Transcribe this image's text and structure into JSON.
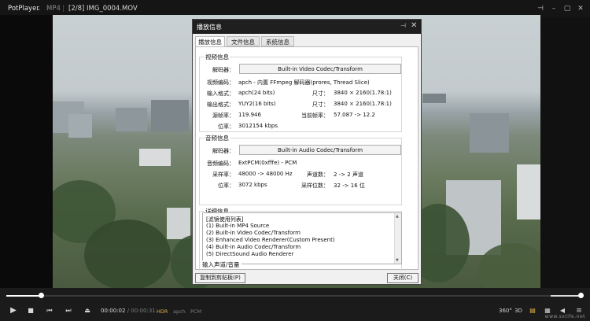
{
  "titlebar": {
    "app_name": "PotPlayer",
    "app_menu_icon": "chevron-down-icon",
    "format": "MP4",
    "separator": "|",
    "title": "[2/8] IMG_0004.MOV",
    "window_controls": [
      "pin-icon",
      "minimize-icon",
      "maximize-icon",
      "close-icon"
    ]
  },
  "dialog": {
    "title": "播放信息",
    "pin_glyph": "⊣",
    "close_glyph": "✕",
    "tabs": [
      "播放信息",
      "文件信息",
      "系统信息"
    ],
    "video": {
      "section_title": "视频信息",
      "decoder_label": "解码器：",
      "decoder_value": "Built-in Video Codec/Transform",
      "codec_label": "视频编码：",
      "codec_value": "apch - 内置 FFmpeg 解码器(prores, Thread Slice)",
      "input_label": "输入格式：",
      "input_value": "apch(24 bits)",
      "input_size_label": "尺寸：",
      "input_size_value": "3840 × 2160(1.78:1)",
      "output_label": "输出格式：",
      "output_value": "YUY2(16 bits)",
      "output_size_label": "尺寸：",
      "output_size_value": "3840 × 2160(1.78:1)",
      "src_fps_label": "源帧率：",
      "src_fps_value": "119.946",
      "cur_fps_label": "当前帧率：",
      "cur_fps_value": "57.087 -> 12.2",
      "bitrate_label": "位率：",
      "bitrate_value": "3012154 kbps"
    },
    "audio": {
      "section_title": "音频信息",
      "decoder_label": "解码器：",
      "decoder_value": "Built-in Audio Codec/Transform",
      "codec_label": "音频编码：",
      "codec_value": "ExtPCM(0xfffe) - PCM",
      "samplerate_label": "采样率：",
      "samplerate_value": "48000 -> 48000 Hz",
      "channels_label": "声道数：",
      "channels_value": "2 -> 2 声道",
      "bitrate_label": "位率：",
      "bitrate_value": "3072 kbps",
      "bitdepth_label": "采样位数：",
      "bitdepth_value": "32 -> 16 位"
    },
    "details": {
      "section_title": "详细信息",
      "lines": [
        "[滤镜使用列表]",
        "(1) Built-in MP4 Source",
        "(2) Built-in Video Codec/Transform",
        "(3) Enhanced Video Renderer(Custom Present)",
        "(4) Built-in Audio Codec/Transform",
        "(5) DirectSound Audio Renderer"
      ]
    },
    "io_section_title": "输入声道/音量",
    "copy_button": "复制到剪贴板(P)",
    "close_button": "关闭(C)"
  },
  "controls": {
    "progress": 0.06,
    "volume": 0.9,
    "current_time": "00:00:02",
    "time_sep": "/",
    "total_time": "00:00:31",
    "tags": [
      "HDR",
      "apch",
      "PCM"
    ],
    "right_labels": [
      "360°",
      "3D"
    ],
    "watermark": "www.sxtife.net"
  }
}
